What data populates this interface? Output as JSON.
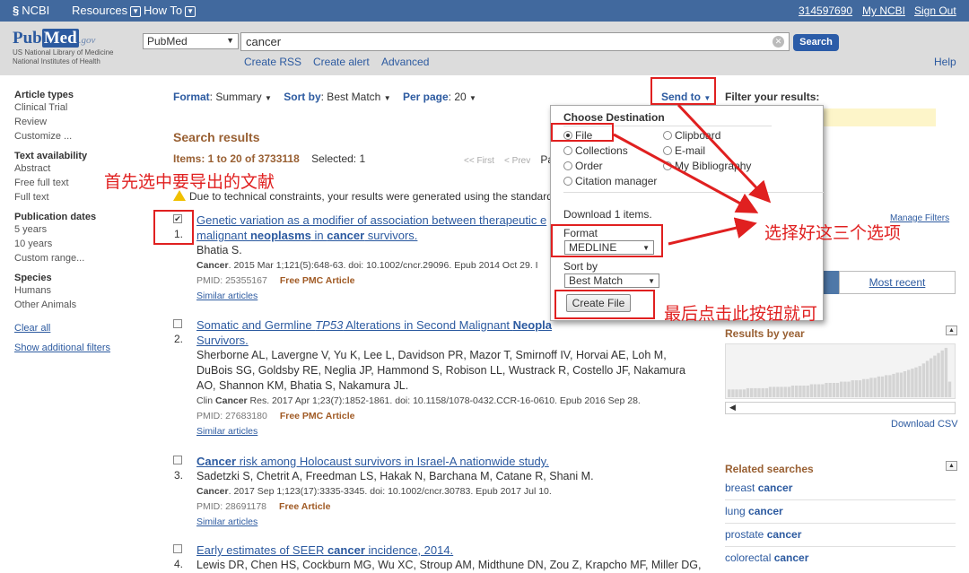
{
  "topbar": {
    "ncbi": "NCBI",
    "resources": "Resources",
    "howto": "How To",
    "user_id": "314597690",
    "my_ncbi": "My NCBI",
    "sign_out": "Sign Out"
  },
  "header": {
    "logo_pub": "Pub",
    "logo_med": "Med",
    "logo_gov": ".gov",
    "logo_sub1": "US National Library of Medicine",
    "logo_sub2": "National Institutes of Health",
    "database": "PubMed",
    "query": "cancer",
    "search_label": "Search",
    "create_rss": "Create RSS",
    "create_alert": "Create alert",
    "advanced": "Advanced",
    "help": "Help"
  },
  "leftnav": {
    "article_types": "Article types",
    "article_items": [
      "Clinical Trial",
      "Review",
      "Customize ..."
    ],
    "text_availability": "Text availability",
    "text_items": [
      "Abstract",
      "Free full text",
      "Full text"
    ],
    "pub_dates": "Publication dates",
    "date_items": [
      "5 years",
      "10 years",
      "Custom range..."
    ],
    "species": "Species",
    "species_items": [
      "Humans",
      "Other Animals"
    ],
    "clear_all": "Clear all",
    "show_filters": "Show additional filters"
  },
  "toolbar": {
    "format_label": "Format",
    "format_value": ": Summary",
    "sortby_label": "Sort by",
    "sortby_value": ": Best Match",
    "perpage_label": "Per page",
    "perpage_value": ": 20",
    "send_to": "Send to"
  },
  "filter_header": "Filter your results:",
  "results": {
    "heading": "Search results",
    "items_text": "Items: 1 to 20 of 3733118",
    "selected": "Selected: 1",
    "first": "<< First",
    "prev": "< Prev",
    "page": "Pa",
    "notice": "Due to technical constraints, your results were generated using the standard",
    "list": [
      {
        "num": "1.",
        "checked": true,
        "title_parts": [
          "Genetic variation as a modifier of association between therapeutic e",
          "malignant ",
          "neoplasms",
          " in ",
          "cancer",
          " survivors."
        ],
        "authors": "Bhatia S.",
        "journal_bold": "Cancer",
        "journal": ". 2015 Mar 1;121(5):648-63. doi: 10.1002/cncr.29096. Epub 2014 Oct 29. I",
        "pmid": "PMID: 25355167",
        "free": "Free PMC Article",
        "similar": "Similar articles"
      },
      {
        "num": "2.",
        "checked": false,
        "title_a": "Somatic and Germline ",
        "title_i": "TP53",
        "title_b": " Alterations in Second Malignant ",
        "title_c": "Neopla",
        "title_d": "Survivors.",
        "authors1": "Sherborne AL, Lavergne V, Yu K, Lee L, Davidson PR, Mazor T, Smirnoff IV, Horvai AE, Loh M,",
        "authors2": "DuBois SG, Goldsby RE, Neglia JP, Hammond S, Robison LL, Wustrack R, Costello JF, Nakamura",
        "authors3": "AO, Shannon KM, Bhatia S, Nakamura JL.",
        "journal_pre": "Clin ",
        "journal_bold": "Cancer",
        "journal": " Res. 2017 Apr 1;23(7):1852-1861. doi: 10.1158/1078-0432.CCR-16-0610. Epub 2016 Sep 28.",
        "pmid": "PMID: 27683180",
        "free": "Free PMC Article",
        "similar": "Similar articles"
      },
      {
        "num": "3.",
        "checked": false,
        "title_bold": "Cancer",
        "title": " risk among Holocaust survivors in Israel-A nationwide study.",
        "authors": "Sadetzki S, Chetrit A, Freedman LS, Hakak N, Barchana M, Catane R, Shani M.",
        "journal_bold": "Cancer",
        "journal": ". 2017 Sep 1;123(17):3335-3345. doi: 10.1002/cncr.30783. Epub 2017 Jul 10.",
        "pmid": "PMID: 28691178",
        "free": "Free Article",
        "similar": "Similar articles"
      },
      {
        "num": "4.",
        "checked": false,
        "title_a": "Early estimates of SEER ",
        "title_bold": "cancer",
        "title_b": " incidence, 2014.",
        "authors": "Lewis DR, Chen HS, Cockburn MG, Wu XC, Stroup AM, Midthune DN, Zou Z, Krapcho MF, Miller DG,"
      }
    ]
  },
  "popup": {
    "title": "Choose Destination",
    "options": {
      "file": "File",
      "clipboard": "Clipboard",
      "collections": "Collections",
      "email": "E-mail",
      "order": "Order",
      "bibliography": "My Bibliography",
      "citation": "Citation manager"
    },
    "download_text": "Download 1 items.",
    "format_label": "Format",
    "format_value": "MEDLINE",
    "sortby_label": "Sort by",
    "sortby_value": "Best Match",
    "create_file": "Create File"
  },
  "annotations": {
    "select_docs": "首先选中要导出的文献",
    "choose_options": "选择好这三个选项",
    "click_button": "最后点击此按钮就可"
  },
  "sidebar": {
    "manage_filters": "Manage Filters",
    "most_recent": "Most recent",
    "results_by_year": "Results by year",
    "download_csv": "Download CSV",
    "related_searches": "Related searches",
    "related": [
      {
        "pre": "breast ",
        "bold": "cancer"
      },
      {
        "pre": "lung ",
        "bold": "cancer"
      },
      {
        "pre": "prostate ",
        "bold": "cancer"
      },
      {
        "pre": "colorectal ",
        "bold": "cancer"
      }
    ]
  },
  "chart_data": {
    "type": "bar",
    "title": "Results by year",
    "values": [
      6,
      6,
      6,
      6,
      6,
      7,
      7,
      7,
      7,
      7,
      7,
      8,
      8,
      8,
      8,
      8,
      8,
      9,
      9,
      9,
      9,
      9,
      10,
      10,
      10,
      10,
      11,
      11,
      11,
      11,
      12,
      12,
      12,
      13,
      13,
      13,
      14,
      14,
      15,
      15,
      16,
      16,
      17,
      17,
      18,
      19,
      19,
      20,
      21,
      22,
      23,
      24,
      26,
      28,
      30,
      32,
      34,
      36,
      38,
      12
    ],
    "ylim": [
      0,
      40
    ]
  },
  "colors": {
    "topbar": "#41699e",
    "link": "#2c5aa0",
    "heading": "#996033",
    "annotation": "#e02020"
  }
}
